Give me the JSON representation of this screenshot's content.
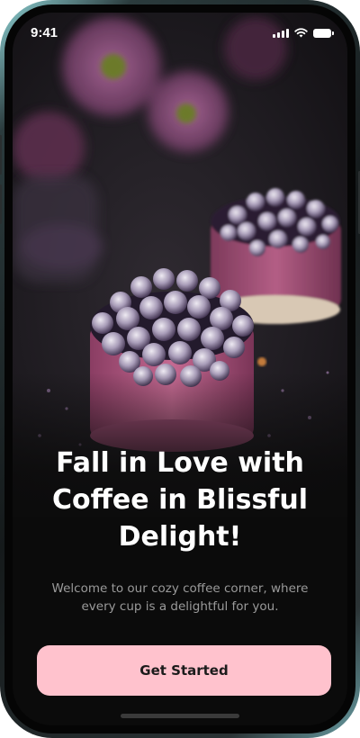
{
  "status_bar": {
    "time": "9:41",
    "icons": [
      "signal-icon",
      "wifi-icon",
      "battery-icon"
    ]
  },
  "hero": {
    "image": "berry-cake-photo",
    "headline": "Fall in Love with Coffee in Blissful Delight!",
    "subtitle": "Welcome to our cozy coffee corner, where every cup is a delightful for you."
  },
  "cta": {
    "label": "Get Started"
  },
  "colors": {
    "background": "#0b0b0b",
    "headline": "#ffffff",
    "subtitle": "#9a9a9a",
    "button_bg": "#ffc2cd",
    "button_text": "#1b1b1b"
  }
}
